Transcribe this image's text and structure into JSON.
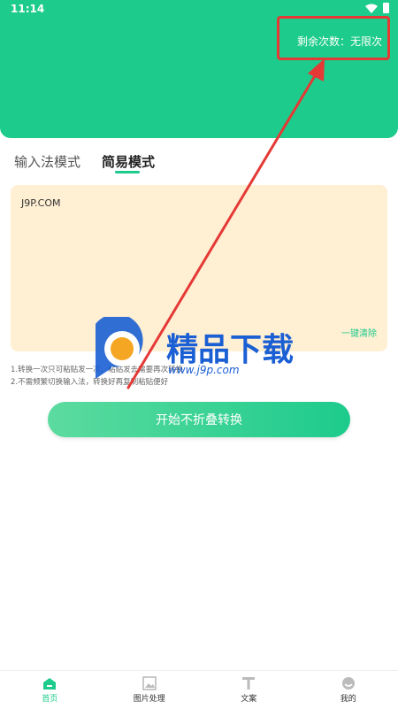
{
  "status": {
    "time": "11:14"
  },
  "header": {
    "remaining_label": "剩余次数：无限次",
    "color": "#1DCB8C"
  },
  "tabs": [
    {
      "label": "输入法模式",
      "active": false
    },
    {
      "label": "简易模式",
      "active": true
    }
  ],
  "input": {
    "text": "J9P.COM",
    "clear_label": "一键清除"
  },
  "hints": [
    "1.转换一次只可粘贴发一次，粘贴发去需要再次转换",
    "2.不需频繁切换输入法，转换好再复制粘贴便好"
  ],
  "start_button": {
    "label": "开始不折叠转换"
  },
  "watermark": {
    "name": "精品下载",
    "url": "www.j9p.com"
  },
  "nav": [
    {
      "label": "首页",
      "icon": "home-icon",
      "active": true
    },
    {
      "label": "图片处理",
      "icon": "image-icon",
      "active": false
    },
    {
      "label": "文案",
      "icon": "text-icon",
      "active": false
    },
    {
      "label": "我的",
      "icon": "profile-icon",
      "active": false
    }
  ],
  "colors": {
    "accent": "#1DCB8C",
    "highlight": "#E53935",
    "input_bg": "#FFEFD3"
  }
}
